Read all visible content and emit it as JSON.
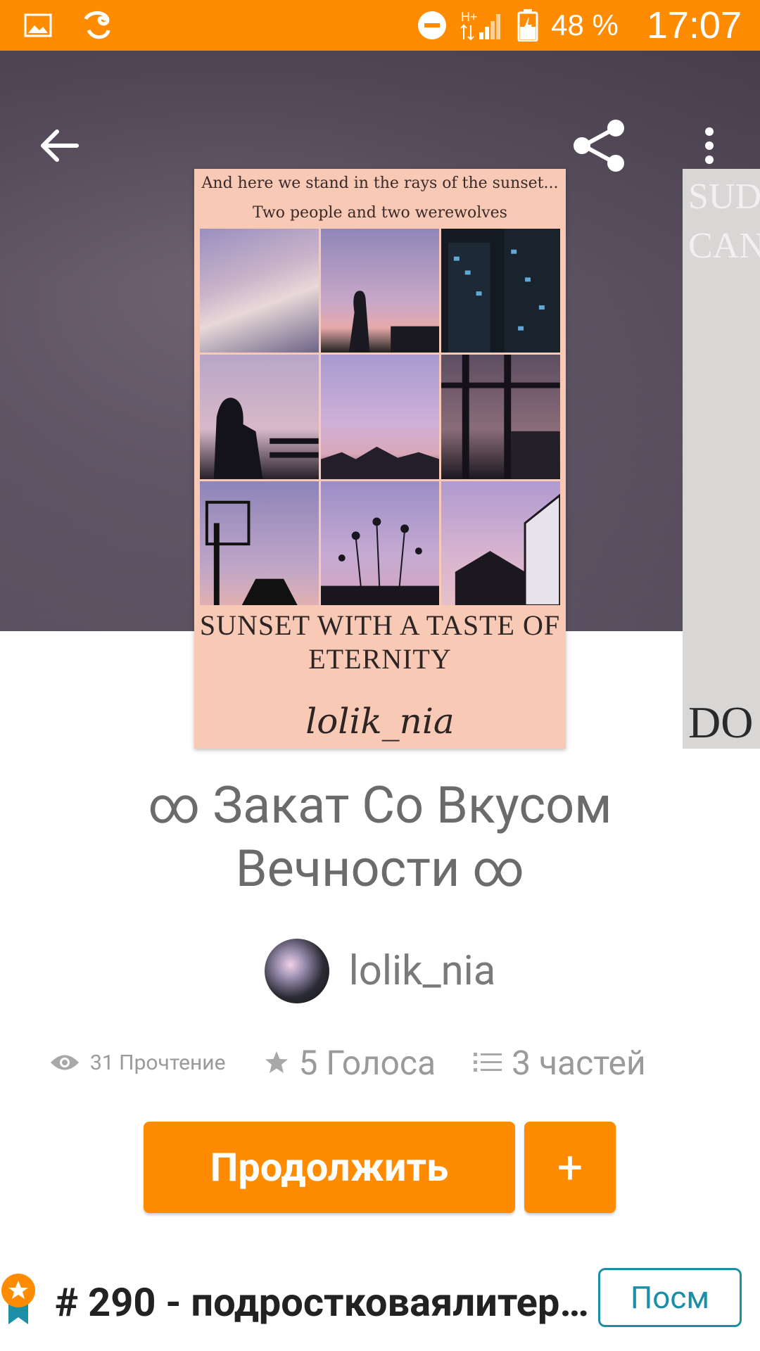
{
  "status_bar": {
    "network": "H+",
    "battery": "48 %",
    "time": "17:07"
  },
  "cover": {
    "tagline_line1": "And here we stand in the rays of the sunset...",
    "tagline_line2": "Two people and two werewolves",
    "title_line1": "SUNSET WITH A TASTE OF",
    "title_line2": "ETERNITY",
    "author": "lolik_nia"
  },
  "next_cover": {
    "line1": "SUD",
    "line2": "CAN",
    "bottom": "DO"
  },
  "story": {
    "title_line1": "∞ Закат Со Вкусом",
    "title_line2": "Вечности ∞",
    "author": "lolik_nia"
  },
  "stats": {
    "reads": "31 Прочтение",
    "votes": "5 Голоса",
    "parts": "3 частей"
  },
  "actions": {
    "continue_label": "Продолжить",
    "add_label": "+"
  },
  "ranking": {
    "text": "# 290 - подростковаялитер...",
    "button_label": "Посм"
  },
  "colors": {
    "accent": "#ff8c00",
    "link": "#1a8fa6"
  }
}
